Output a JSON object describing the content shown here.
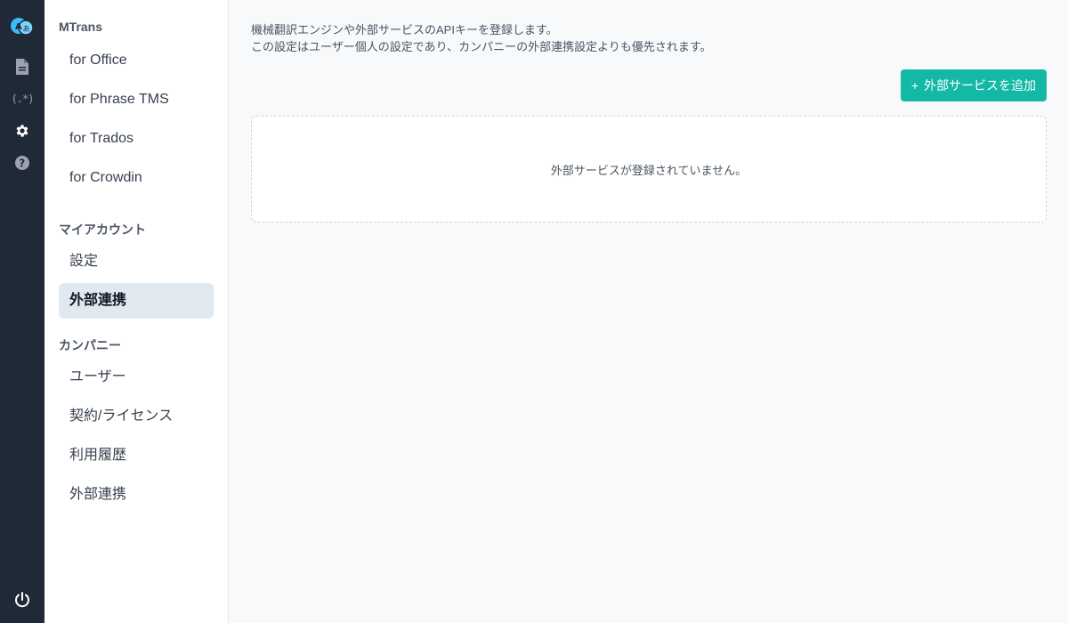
{
  "rail": {
    "icons": [
      "app-logo-icon",
      "document-icon",
      "regex-icon",
      "gear-icon",
      "help-icon",
      "power-icon"
    ],
    "regex_label": "(.*)"
  },
  "sidebar": {
    "mtrans": {
      "title": "MTrans",
      "items": [
        {
          "label": "for Office"
        },
        {
          "label": "for Phrase TMS"
        },
        {
          "label": "for Trados"
        },
        {
          "label": "for Crowdin"
        }
      ]
    },
    "account": {
      "title": "マイアカウント",
      "items": [
        {
          "label": "設定"
        },
        {
          "label": "外部連携",
          "active": true
        }
      ]
    },
    "company": {
      "title": "カンパニー",
      "items": [
        {
          "label": "ユーザー"
        },
        {
          "label": "契約/ライセンス"
        },
        {
          "label": "利用履歴"
        },
        {
          "label": "外部連携"
        }
      ]
    }
  },
  "main": {
    "description_line1": "機械翻訳エンジンや外部サービスのAPIキーを登録します。",
    "description_line2": "この設定はユーザー個人の設定であり、カンパニーの外部連携設定よりも優先されます。",
    "add_button_icon": "+",
    "add_button_label": "外部サービスを追加",
    "empty_message": "外部サービスが登録されていません。"
  },
  "colors": {
    "rail_bg": "#1f2937",
    "accent": "#14b8a6",
    "active_item_bg": "#e2e8ef"
  }
}
